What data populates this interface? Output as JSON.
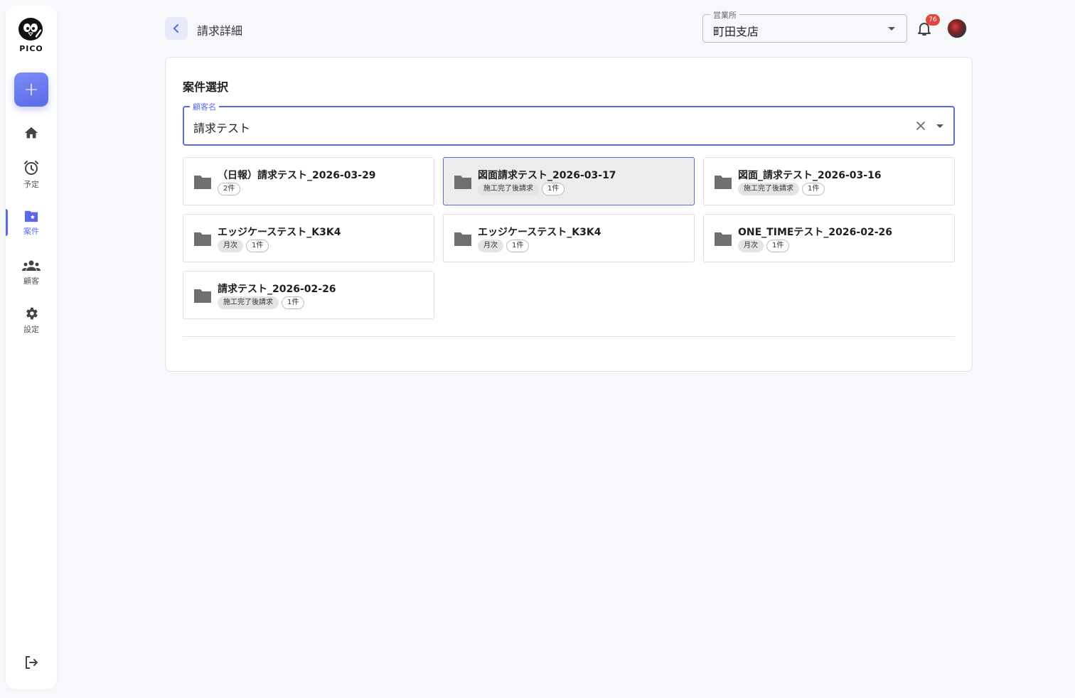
{
  "sidebar": {
    "logo_text": "PICO",
    "add_label": "+",
    "items": [
      {
        "key": "home",
        "label": ""
      },
      {
        "key": "schedule",
        "label": "予定"
      },
      {
        "key": "projects",
        "label": "案件"
      },
      {
        "key": "customers",
        "label": "顧客"
      },
      {
        "key": "settings",
        "label": "設定"
      }
    ],
    "active": "projects"
  },
  "header": {
    "title": "請求詳細",
    "branch_label": "営業所",
    "branch_value": "町田支店",
    "notification_count": "76"
  },
  "card": {
    "section_title": "案件選択",
    "customer_label": "顧客名",
    "customer_value": "請求テスト",
    "projects": [
      {
        "name": "（日報）請求テスト_2026-03-29",
        "type": "",
        "count": "2件",
        "selected": false
      },
      {
        "name": "図面請求テスト_2026-03-17",
        "type": "施工完了後請求",
        "count": "1件",
        "selected": true
      },
      {
        "name": "図面_請求テスト_2026-03-16",
        "type": "施工完了後請求",
        "count": "1件",
        "selected": false
      },
      {
        "name": "エッジケーステスト_K3K4",
        "type": "月次",
        "count": "1件",
        "selected": false
      },
      {
        "name": "エッジケーステスト_K3K4",
        "type": "月次",
        "count": "1件",
        "selected": false
      },
      {
        "name": "ONE_TIMEテスト_2026-02-26",
        "type": "月次",
        "count": "1件",
        "selected": false
      },
      {
        "name": "請求テスト_2026-02-26",
        "type": "施工完了後請求",
        "count": "1件",
        "selected": false
      }
    ]
  },
  "colors": {
    "accent": "#5a6ae6",
    "badge": "#e0463f",
    "folder": "#6f6f6f"
  }
}
